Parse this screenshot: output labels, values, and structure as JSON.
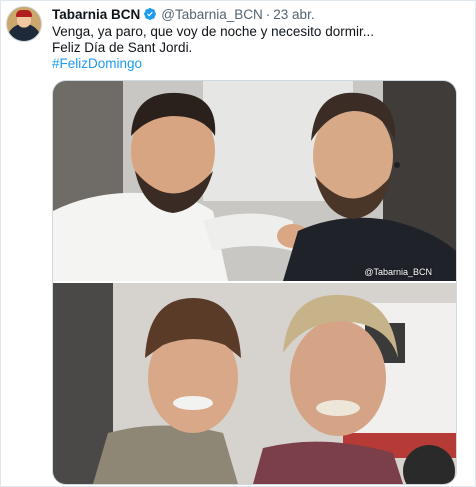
{
  "tweet": {
    "author_name": "Tabarnia BCN",
    "author_handle": "@Tabarnia_BCN",
    "separator": "·",
    "time": "23 abr.",
    "lines": [
      "Venga, ya paro, que voy de noche y necesito dormir...",
      "Feliz Día de Sant Jordi."
    ],
    "hashtag": "#FelizDomingo",
    "watermark": "@Tabarnia_BCN"
  },
  "colors": {
    "accent": "#1d9bf0",
    "text": "#0f1419",
    "muted": "#536471"
  },
  "icons": {
    "verified": "verified-badge-icon"
  }
}
